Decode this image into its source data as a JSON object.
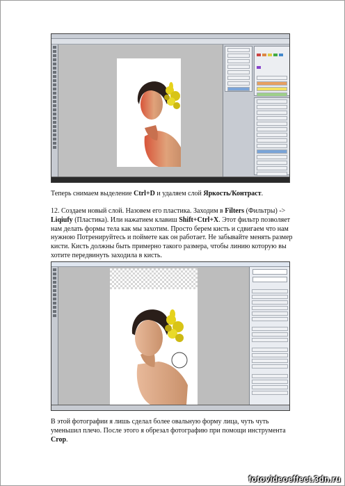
{
  "captions": {
    "p1": {
      "t1": "Теперь снимаем выделение ",
      "k1": "Ctrl+D",
      "t2": " и удаляем слой ",
      "k2": "Яркость/Контраст",
      "t3": "."
    },
    "p2": {
      "t1": "12. Создаем новый слой. Назовем его пластика. Заходим в ",
      "k1": "Filters",
      "t2": " (Фильтры) -> ",
      "k2": "Liqiufy",
      "t3": " (Пластика). Или нажатием клавиш ",
      "k3": "Shift+Ctrl+X",
      "t4": ". Этот фильтр позволяет нам делать формы тела как мы захотим. Просто берем кисть и сдвигаем что нам нужною Потренируйтесь и поймете как он работает. Не забывайте менять размер кисти. Кисть должны быть примерно такого размера, чтобы линию которую вы хотите передвинуть заходила в кисть."
    },
    "p3": {
      "t1": "В этой фотографии я лишь сделал более овальную форму лица, чуть чуть уменьшил плечо. После этого я обрезал фотографию при помощи инструмента ",
      "k1": "Crop",
      "t2": "."
    }
  },
  "watermark": "fotovideoeffect.3dn.ru",
  "colors": {
    "ui_gray": "#c7cbd2",
    "canvas_gray": "#bfbfbf",
    "highlight_blue": "#7aa4d8",
    "flower_yellow": "#e6d21c",
    "skin_red": "#d8553a"
  }
}
